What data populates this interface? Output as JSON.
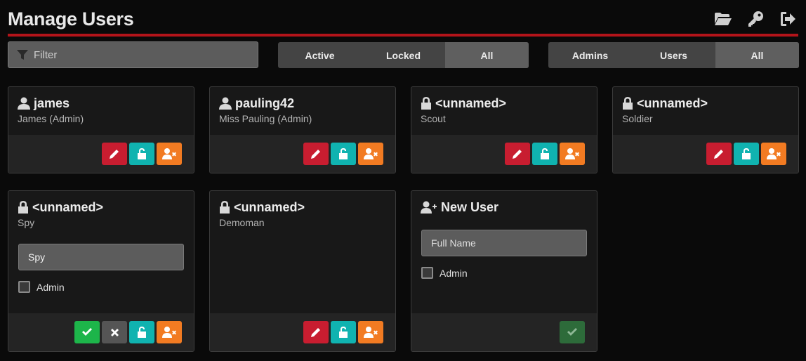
{
  "header": {
    "title": "Manage Users"
  },
  "filter": {
    "placeholder": "Filter"
  },
  "status_filter": {
    "options": [
      "Active",
      "Locked",
      "All"
    ],
    "selected": "All"
  },
  "role_filter": {
    "options": [
      "Admins",
      "Users",
      "All"
    ],
    "selected": "All"
  },
  "users": [
    {
      "title": "james",
      "subtitle": "James (Admin)"
    },
    {
      "title": "pauling42",
      "subtitle": "Miss Pauling (Admin)"
    },
    {
      "title": "<unnamed>",
      "subtitle": "Scout"
    },
    {
      "title": "<unnamed>",
      "subtitle": "Soldier"
    },
    {
      "title": "<unnamed>",
      "subtitle": "Spy",
      "edit_value": "Spy",
      "admin_label": "Admin"
    },
    {
      "title": "<unnamed>",
      "subtitle": "Demoman"
    }
  ],
  "new_user": {
    "title": "New User",
    "placeholder": "Full Name",
    "admin_label": "Admin"
  },
  "colors": {
    "accent": "#b3141a",
    "edit": "#c81d30",
    "unlock": "#10b3b0",
    "delete": "#f27b22",
    "save": "#1db54a"
  }
}
